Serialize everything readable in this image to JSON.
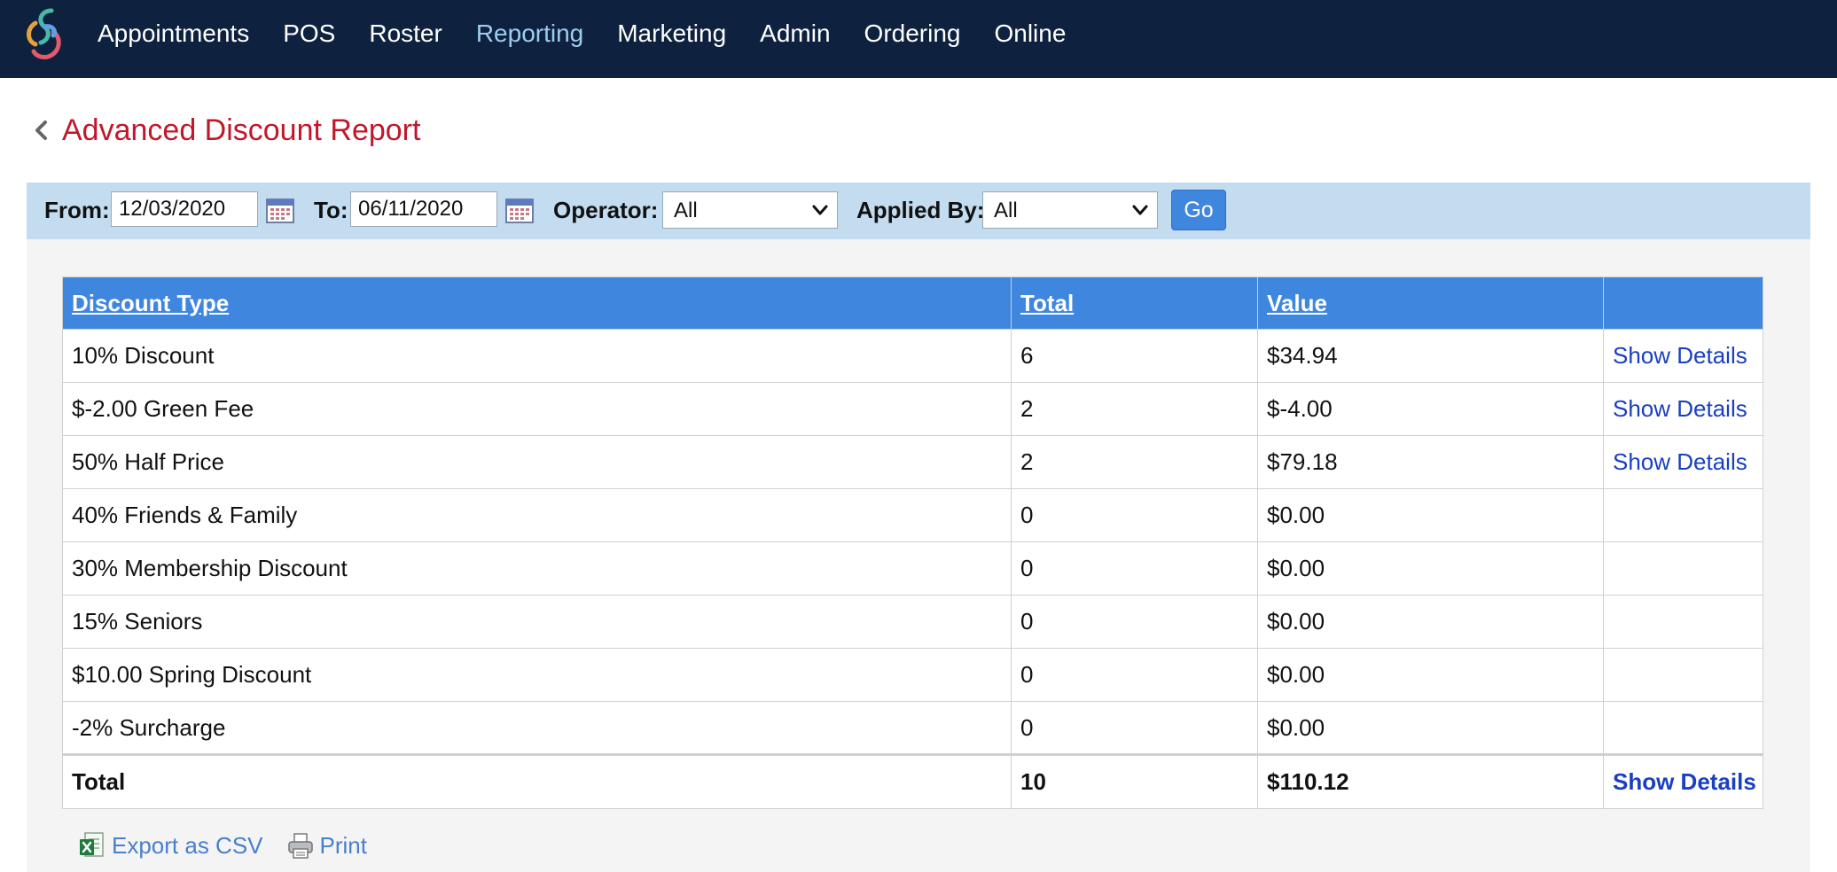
{
  "nav": {
    "items": [
      {
        "label": "Appointments"
      },
      {
        "label": "POS"
      },
      {
        "label": "Roster"
      },
      {
        "label": "Reporting"
      },
      {
        "label": "Marketing"
      },
      {
        "label": "Admin"
      },
      {
        "label": "Ordering"
      },
      {
        "label": "Online"
      }
    ],
    "active": "Reporting"
  },
  "page": {
    "title": "Advanced Discount Report",
    "title_color": "#c0182b"
  },
  "filters": {
    "from_label": "From:",
    "from_value": "12/03/2020",
    "to_label": "To:",
    "to_value": "06/11/2020",
    "operator_label": "Operator:",
    "operator_value": "All",
    "applied_by_label": "Applied By:",
    "applied_by_value": "All",
    "go_label": "Go"
  },
  "table": {
    "headers": {
      "discount_type": "Discount Type",
      "total": "Total",
      "value": "Value"
    },
    "rows": [
      {
        "type": "10% Discount",
        "total": "6",
        "value": "$34.94",
        "details": "Show Details"
      },
      {
        "type": "$-2.00 Green Fee",
        "total": "2",
        "value": "$-4.00",
        "details": "Show Details"
      },
      {
        "type": "50% Half Price",
        "total": "2",
        "value": "$79.18",
        "details": "Show Details"
      },
      {
        "type": "40% Friends & Family",
        "total": "0",
        "value": "$0.00",
        "details": ""
      },
      {
        "type": "30% Membership Discount",
        "total": "0",
        "value": "$0.00",
        "details": ""
      },
      {
        "type": "15% Seniors",
        "total": "0",
        "value": "$0.00",
        "details": ""
      },
      {
        "type": "$10.00 Spring Discount",
        "total": "0",
        "value": "$0.00",
        "details": ""
      },
      {
        "type": "-2% Surcharge",
        "total": "0",
        "value": "$0.00",
        "details": ""
      }
    ],
    "total_row": {
      "label": "Total",
      "total": "10",
      "value": "$110.12",
      "details": "Show Details"
    }
  },
  "footer": {
    "export_label": "Export as CSV",
    "print_label": "Print"
  },
  "colors": {
    "nav_bg": "#0e2240",
    "nav_active": "#9fcdf0",
    "filter_bar_bg": "#c3dcef",
    "table_header_bg": "#3f86df",
    "link": "#1a3fc0"
  },
  "icons": {
    "logo": "app-logo",
    "back": "chevron-left-icon",
    "calendar": "calendar-icon",
    "dropdown": "chevron-down-icon",
    "export": "excel-icon",
    "print": "printer-icon"
  }
}
